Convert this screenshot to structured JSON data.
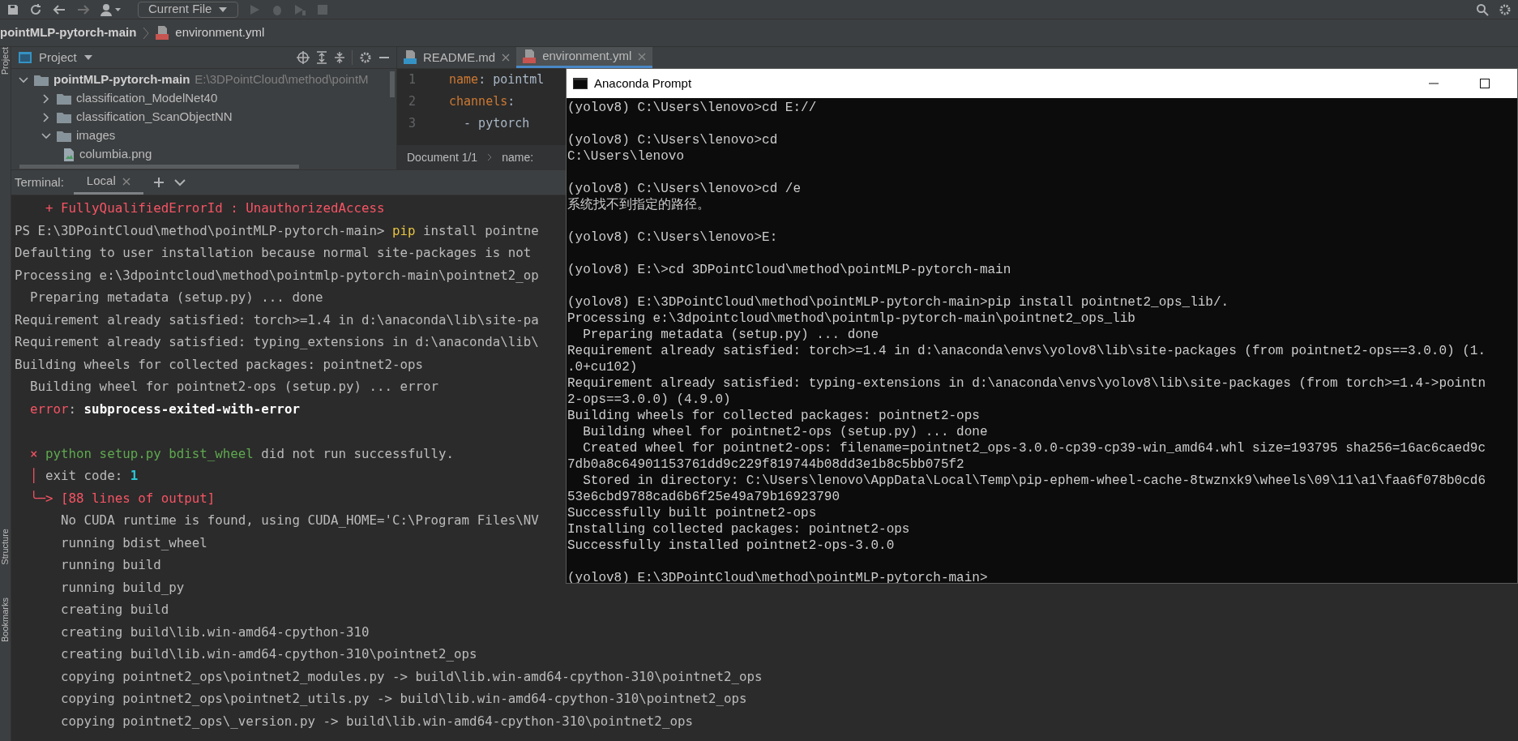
{
  "toolbar": {
    "run_config": "Current File"
  },
  "breadcrumb": {
    "project": "pointMLP-pytorch-main",
    "file": "environment.yml"
  },
  "side_strip": [
    "Project",
    "Structure",
    "Bookmarks"
  ],
  "project_panel": {
    "title": "Project",
    "tree": [
      {
        "label": "pointMLP-pytorch-main",
        "path": "E:\\3DPointCloud\\method\\pointM",
        "kind": "folder",
        "expanded": true,
        "children": [
          {
            "label": "classification_ModelNet40",
            "kind": "folder",
            "expanded": false
          },
          {
            "label": "classification_ScanObjectNN",
            "kind": "folder",
            "expanded": false
          },
          {
            "label": "images",
            "kind": "folder",
            "expanded": true,
            "children": [
              {
                "label": "columbia.png",
                "kind": "image"
              }
            ]
          }
        ]
      }
    ]
  },
  "editor": {
    "tabs": [
      {
        "label": "README.md",
        "kind": "md",
        "selected": false
      },
      {
        "label": "environment.yml",
        "kind": "yml",
        "selected": true
      }
    ],
    "lines": [
      {
        "number": "1",
        "segments": [
          {
            "text": "name",
            "kind": "key"
          },
          {
            "text": ": ",
            "kind": "plain"
          },
          {
            "text": "pointml",
            "kind": "plain"
          }
        ]
      },
      {
        "number": "2",
        "segments": [
          {
            "text": "channels",
            "kind": "key"
          },
          {
            "text": ":",
            "kind": "plain"
          }
        ]
      },
      {
        "number": "3",
        "segments": [
          {
            "text": "  - pytorch",
            "kind": "plain"
          }
        ]
      }
    ],
    "breadcrumb": [
      "Document 1/1",
      "name:"
    ]
  },
  "terminal": {
    "label": "Terminal:",
    "tabs": [
      {
        "label": "Local",
        "selected": true
      }
    ],
    "blocks": [
      [
        [
          {
            "text": "    + FullyQualifiedErrorId : UnauthorizedAccess",
            "kind": "error"
          }
        ],
        [
          {
            "text": "PS E:\\3DPointCloud\\method\\pointMLP-pytorch-main> ",
            "kind": "plain"
          },
          {
            "text": "pip",
            "kind": "keyword"
          },
          {
            "text": " install pointne",
            "kind": "plain"
          }
        ],
        [
          {
            "text": "Defaulting to user installation because normal site-packages is not",
            "kind": "plain"
          }
        ],
        [
          {
            "text": "Processing e:\\3dpointcloud\\method\\pointmlp-pytorch-main\\pointnet2_op",
            "kind": "plain"
          }
        ],
        [
          {
            "text": "  Preparing metadata (setup.py) ... done",
            "kind": "plain"
          }
        ],
        [
          {
            "text": "Requirement already satisfied: torch>=1.4 in d:\\anaconda\\lib\\site-pa",
            "kind": "plain"
          }
        ],
        [
          {
            "text": "Requirement already satisfied: typing_extensions in d:\\anaconda\\lib\\",
            "kind": "plain"
          }
        ],
        [
          {
            "text": "Building wheels for collected packages: pointnet2-ops",
            "kind": "plain"
          }
        ],
        [
          {
            "text": "  Building wheel for pointnet2-ops (setup.py) ... error",
            "kind": "plain"
          }
        ],
        [
          {
            "text": "  error",
            "kind": "error"
          },
          {
            "text": ": ",
            "kind": "plain"
          },
          {
            "text": "subprocess-exited-with-error",
            "kind": "strong"
          }
        ]
      ],
      [
        [
          {
            "text": "  × ",
            "kind": "error"
          },
          {
            "text": "python setup.py bdist_wheel",
            "kind": "command"
          },
          {
            "text": " did not run successfully.",
            "kind": "plain"
          }
        ],
        [
          {
            "text": "  │",
            "kind": "error"
          },
          {
            "text": " exit code: ",
            "kind": "plain"
          },
          {
            "text": "1",
            "kind": "number"
          }
        ],
        [
          {
            "text": "  ╰─> [88 lines of output]",
            "kind": "error"
          }
        ],
        [
          {
            "text": "      No CUDA runtime is found, using CUDA_HOME='C:\\Program Files\\NV",
            "kind": "plain"
          }
        ],
        [
          {
            "text": "      running bdist_wheel",
            "kind": "plain"
          }
        ],
        [
          {
            "text": "      running build",
            "kind": "plain"
          }
        ],
        [
          {
            "text": "      running build_py",
            "kind": "plain"
          }
        ],
        [
          {
            "text": "      creating build",
            "kind": "plain"
          }
        ],
        [
          {
            "text": "      creating build\\lib.win-amd64-cpython-310",
            "kind": "plain"
          }
        ],
        [
          {
            "text": "      creating build\\lib.win-amd64-cpython-310\\pointnet2_ops",
            "kind": "plain"
          }
        ],
        [
          {
            "text": "      copying pointnet2_ops\\pointnet2_modules.py -> build\\lib.win-amd64-cpython-310\\pointnet2_ops",
            "kind": "plain"
          }
        ],
        [
          {
            "text": "      copying pointnet2_ops\\pointnet2_utils.py -> build\\lib.win-amd64-cpython-310\\pointnet2_ops",
            "kind": "plain"
          }
        ],
        [
          {
            "text": "      copying pointnet2_ops\\_version.py -> build\\lib.win-amd64-cpython-310\\pointnet2_ops",
            "kind": "plain"
          }
        ]
      ]
    ]
  },
  "console_window": {
    "title": "Anaconda Prompt",
    "blocks": [
      [
        "(yolov8) C:\\Users\\lenovo>cd E://"
      ],
      [
        "(yolov8) C:\\Users\\lenovo>cd",
        "C:\\Users\\lenovo"
      ],
      [
        "(yolov8) C:\\Users\\lenovo>cd /e",
        "系统找不到指定的路径。"
      ],
      [
        "(yolov8) C:\\Users\\lenovo>E:"
      ],
      [
        "(yolov8) E:\\>cd 3DPointCloud\\method\\pointMLP-pytorch-main"
      ],
      [
        "(yolov8) E:\\3DPointCloud\\method\\pointMLP-pytorch-main>pip install pointnet2_ops_lib/.",
        "Processing e:\\3dpointcloud\\method\\pointmlp-pytorch-main\\pointnet2_ops_lib",
        "  Preparing metadata (setup.py) ... done",
        "Requirement already satisfied: torch>=1.4 in d:\\anaconda\\envs\\yolov8\\lib\\site-packages (from pointnet2-ops==3.0.0) (1.",
        ".0+cu102)",
        "Requirement already satisfied: typing-extensions in d:\\anaconda\\envs\\yolov8\\lib\\site-packages (from torch>=1.4->pointn",
        "2-ops==3.0.0) (4.9.0)",
        "Building wheels for collected packages: pointnet2-ops",
        "  Building wheel for pointnet2-ops (setup.py) ... done",
        "  Created wheel for pointnet2-ops: filename=pointnet2_ops-3.0.0-cp39-cp39-win_amd64.whl size=193795 sha256=16ac6caed9c",
        "7db0a8c64901153761dd9c229f819744b08dd3e1b8c5bb075f2",
        "  Stored in directory: C:\\Users\\lenovo\\AppData\\Local\\Temp\\pip-ephem-wheel-cache-8twznxk9\\wheels\\09\\11\\a1\\faa6f078b0cd6",
        "53e6cbd9788cad6b6f25e49a79b16923790",
        "Successfully built pointnet2-ops",
        "Installing collected packages: pointnet2-ops",
        "Successfully installed pointnet2-ops-3.0.0"
      ],
      [
        "(yolov8) E:\\3DPointCloud\\method\\pointMLP-pytorch-main>"
      ]
    ]
  }
}
